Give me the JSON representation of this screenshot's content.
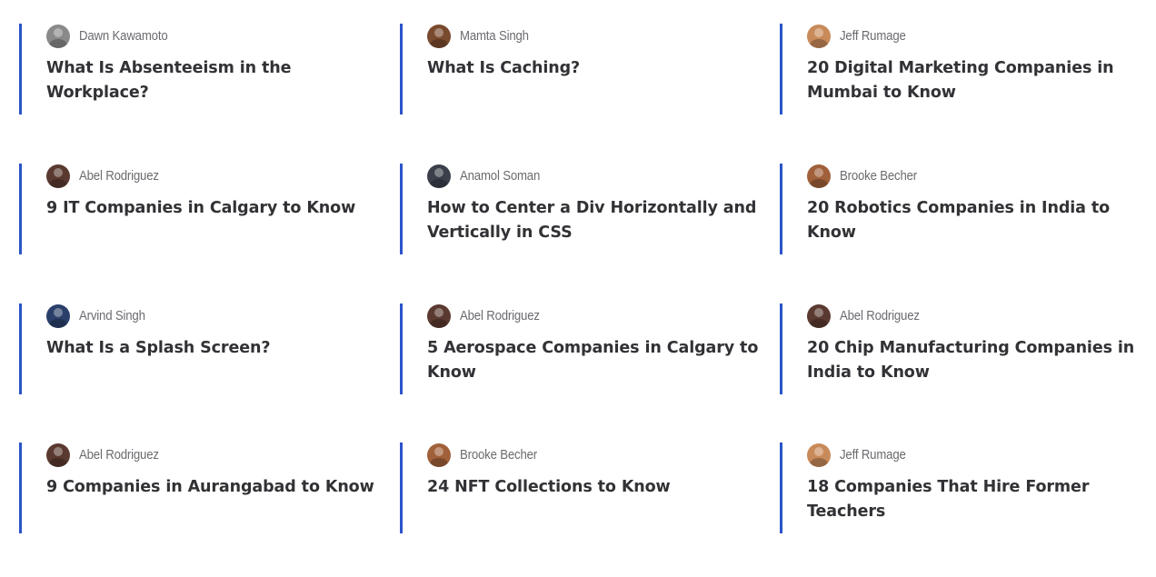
{
  "articles": [
    {
      "author": "Dawn Kawamoto",
      "title": "What Is Absenteeism in the Workplace?",
      "avatar_color": "#8a8a8a"
    },
    {
      "author": "Mamta Singh",
      "title": "What Is Caching?",
      "avatar_color": "#7a4a2e"
    },
    {
      "author": "Jeff Rumage",
      "title": "20 Digital Marketing Companies in Mumbai to Know",
      "avatar_color": "#c98a5a"
    },
    {
      "author": "Abel Rodriguez",
      "title": "9 IT Companies in Calgary to Know",
      "avatar_color": "#5a3a30"
    },
    {
      "author": "Anamol Soman",
      "title": "How to Center a Div Horizontally and Vertically in CSS",
      "avatar_color": "#3a3f4a"
    },
    {
      "author": "Brooke Becher",
      "title": "20 Robotics Companies in India to Know",
      "avatar_color": "#a0603a"
    },
    {
      "author": "Arvind Singh",
      "title": "What Is a Splash Screen?",
      "avatar_color": "#2a3f6a"
    },
    {
      "author": "Abel Rodriguez",
      "title": "5 Aerospace Companies in Calgary to Know",
      "avatar_color": "#5a3a30"
    },
    {
      "author": "Abel Rodriguez",
      "title": "20 Chip Manufacturing Companies in India to Know",
      "avatar_color": "#5a3a30"
    },
    {
      "author": "Abel Rodriguez",
      "title": "9 Companies in Aurangabad to Know",
      "avatar_color": "#5a3a30"
    },
    {
      "author": "Brooke Becher",
      "title": "24 NFT Collections to Know",
      "avatar_color": "#a0603a"
    },
    {
      "author": "Jeff Rumage",
      "title": "18 Companies That Hire Former Teachers",
      "avatar_color": "#c98a5a"
    }
  ],
  "colors": {
    "accent": "#2a54c9",
    "title": "#323236",
    "author": "#6b6b70"
  }
}
